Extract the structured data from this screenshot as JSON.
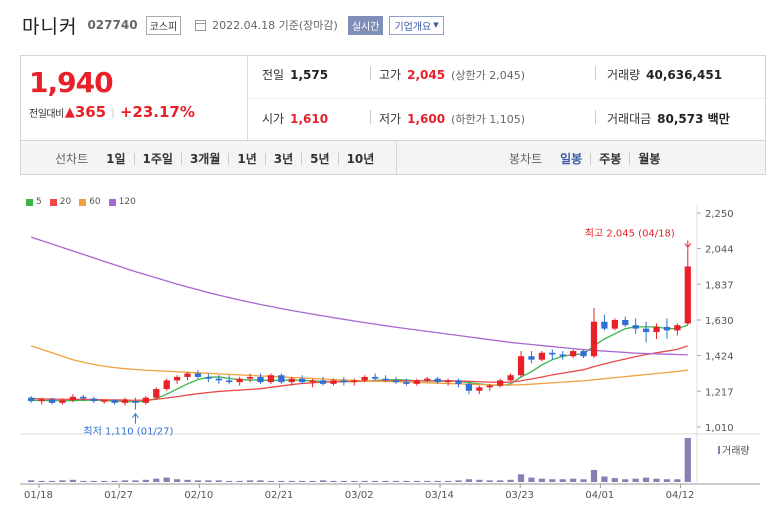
{
  "header": {
    "name": "마니커",
    "code": "027740",
    "market": "코스피",
    "date_text": "2022.04.18 기준(장마감)",
    "realtime_label": "실시간",
    "company_label": "기업개요"
  },
  "price": {
    "current": "1,940",
    "change_label": "전일대비",
    "change_value": "365",
    "change_pct": "+23.17%",
    "prev_label": "전일",
    "prev": "1,575",
    "high_label": "고가",
    "high": "2,045",
    "upper_limit": "상한가 2,045",
    "volume_label": "거래량",
    "volume": "40,636,451",
    "open_label": "시가",
    "open": "1,610",
    "low_label": "저가",
    "low": "1,600",
    "lower_limit": "하한가 1,105",
    "amount_label": "거래대금",
    "amount": "80,573 백만"
  },
  "tabs": {
    "line_label": "선차트",
    "line_tabs": [
      "1일",
      "1주일",
      "3개월",
      "1년",
      "3년",
      "5년",
      "10년"
    ],
    "candle_label": "봉차트",
    "candle_tabs": [
      "일봉",
      "주봉",
      "월봉"
    ],
    "candle_active": "일봉"
  },
  "colors": {
    "up": "#e8202a",
    "down": "#2f6fd6",
    "ma5": "#39b54a",
    "ma20": "#e84a4a",
    "ma60": "#f0a040",
    "ma120": "#a868d0"
  },
  "chart_data": {
    "type": "candlestick",
    "legend": [
      {
        "name": "5",
        "color": "#39b54a"
      },
      {
        "name": "20",
        "color": "#e84a4a"
      },
      {
        "name": "60",
        "color": "#f0a040"
      },
      {
        "name": "120",
        "color": "#a868d0"
      }
    ],
    "y_ticks": [
      "2,250",
      "2,044",
      "1,837",
      "1,630",
      "1,424",
      "1,217",
      "1,010"
    ],
    "y_range": [
      1010,
      2250
    ],
    "x_labels": [
      "01/18",
      "01/27",
      "02/10",
      "02/21",
      "03/02",
      "03/14",
      "03/23",
      "04/01",
      "04/12"
    ],
    "max_annotation": "최고 2,045 (04/18)",
    "min_annotation": "최저 1,110 (01/27)",
    "volume_label": "거래량",
    "ohlc": [
      [
        1180,
        1190,
        1150,
        1160
      ],
      [
        1160,
        1180,
        1140,
        1170
      ],
      [
        1170,
        1180,
        1140,
        1150
      ],
      [
        1150,
        1175,
        1140,
        1165
      ],
      [
        1165,
        1200,
        1155,
        1185
      ],
      [
        1185,
        1195,
        1160,
        1175
      ],
      [
        1175,
        1185,
        1150,
        1160
      ],
      [
        1160,
        1170,
        1145,
        1165
      ],
      [
        1165,
        1170,
        1140,
        1150
      ],
      [
        1150,
        1180,
        1135,
        1170
      ],
      [
        1160,
        1180,
        1110,
        1150
      ],
      [
        1150,
        1190,
        1140,
        1180
      ],
      [
        1180,
        1240,
        1175,
        1230
      ],
      [
        1230,
        1290,
        1220,
        1280
      ],
      [
        1280,
        1310,
        1260,
        1300
      ],
      [
        1300,
        1330,
        1280,
        1320
      ],
      [
        1320,
        1340,
        1290,
        1300
      ],
      [
        1300,
        1320,
        1270,
        1290
      ],
      [
        1290,
        1310,
        1260,
        1280
      ],
      [
        1280,
        1310,
        1260,
        1270
      ],
      [
        1270,
        1300,
        1250,
        1290
      ],
      [
        1290,
        1320,
        1270,
        1300
      ],
      [
        1300,
        1320,
        1260,
        1270
      ],
      [
        1270,
        1320,
        1260,
        1310
      ],
      [
        1310,
        1320,
        1260,
        1270
      ],
      [
        1270,
        1300,
        1250,
        1290
      ],
      [
        1290,
        1310,
        1260,
        1270
      ],
      [
        1270,
        1290,
        1240,
        1280
      ],
      [
        1280,
        1300,
        1250,
        1260
      ],
      [
        1260,
        1290,
        1250,
        1280
      ],
      [
        1280,
        1300,
        1250,
        1270
      ],
      [
        1270,
        1290,
        1250,
        1280
      ],
      [
        1280,
        1310,
        1270,
        1300
      ],
      [
        1300,
        1320,
        1280,
        1290
      ],
      [
        1290,
        1310,
        1270,
        1280
      ],
      [
        1280,
        1300,
        1260,
        1270
      ],
      [
        1270,
        1290,
        1250,
        1260
      ],
      [
        1260,
        1290,
        1250,
        1280
      ],
      [
        1280,
        1300,
        1270,
        1290
      ],
      [
        1290,
        1300,
        1260,
        1270
      ],
      [
        1270,
        1290,
        1250,
        1280
      ],
      [
        1280,
        1290,
        1240,
        1260
      ],
      [
        1260,
        1270,
        1200,
        1220
      ],
      [
        1220,
        1250,
        1200,
        1240
      ],
      [
        1240,
        1260,
        1220,
        1250
      ],
      [
        1250,
        1290,
        1240,
        1280
      ],
      [
        1280,
        1320,
        1270,
        1310
      ],
      [
        1310,
        1450,
        1300,
        1420
      ],
      [
        1420,
        1450,
        1380,
        1400
      ],
      [
        1400,
        1450,
        1390,
        1440
      ],
      [
        1440,
        1460,
        1400,
        1430
      ],
      [
        1430,
        1450,
        1400,
        1420
      ],
      [
        1420,
        1460,
        1410,
        1450
      ],
      [
        1450,
        1460,
        1410,
        1420
      ],
      [
        1420,
        1700,
        1410,
        1620
      ],
      [
        1620,
        1660,
        1570,
        1580
      ],
      [
        1580,
        1640,
        1570,
        1630
      ],
      [
        1630,
        1650,
        1590,
        1600
      ],
      [
        1600,
        1640,
        1550,
        1580
      ],
      [
        1580,
        1620,
        1500,
        1560
      ],
      [
        1560,
        1610,
        1520,
        1590
      ],
      [
        1590,
        1640,
        1520,
        1570
      ],
      [
        1570,
        1610,
        1540,
        1600
      ],
      [
        1610,
        2045,
        1600,
        1940
      ]
    ],
    "volume": [
      3,
      2,
      2,
      3,
      4,
      2,
      2,
      2,
      2,
      3,
      3,
      4,
      6,
      8,
      5,
      4,
      3,
      3,
      3,
      2,
      2,
      3,
      3,
      2,
      2,
      2,
      2,
      2,
      3,
      2,
      2,
      2,
      2,
      2,
      2,
      2,
      2,
      2,
      2,
      2,
      2,
      3,
      5,
      4,
      3,
      3,
      4,
      14,
      8,
      6,
      5,
      5,
      6,
      5,
      22,
      10,
      7,
      5,
      6,
      8,
      6,
      5,
      5,
      80
    ],
    "ma": {
      "5": [
        1165,
        1164,
        1163,
        1162,
        1163,
        1165,
        1166,
        1164,
        1160,
        1158,
        1156,
        1160,
        1175,
        1200,
        1230,
        1260,
        1285,
        1298,
        1300,
        1292,
        1284,
        1282,
        1282,
        1280,
        1282,
        1282,
        1280,
        1277,
        1275,
        1272,
        1272,
        1274,
        1276,
        1280,
        1282,
        1284,
        1282,
        1278,
        1276,
        1276,
        1277,
        1275,
        1268,
        1260,
        1254,
        1250,
        1260,
        1300,
        1330,
        1370,
        1400,
        1420,
        1430,
        1433,
        1480,
        1520,
        1550,
        1580,
        1590,
        1590,
        1590,
        1580,
        1580,
        1600
      ],
      "20": [
        1175,
        1173,
        1172,
        1171,
        1170,
        1170,
        1169,
        1168,
        1167,
        1166,
        1165,
        1166,
        1170,
        1178,
        1186,
        1195,
        1203,
        1210,
        1216,
        1220,
        1224,
        1228,
        1232,
        1240,
        1248,
        1256,
        1262,
        1266,
        1270,
        1272,
        1274,
        1275,
        1276,
        1277,
        1278,
        1278,
        1278,
        1278,
        1278,
        1278,
        1278,
        1277,
        1275,
        1272,
        1270,
        1268,
        1270,
        1278,
        1288,
        1300,
        1312,
        1322,
        1332,
        1342,
        1360,
        1376,
        1390,
        1404,
        1418,
        1430,
        1440,
        1450,
        1460,
        1480
      ],
      "60": [
        1480,
        1460,
        1440,
        1420,
        1400,
        1385,
        1372,
        1362,
        1354,
        1348,
        1343,
        1339,
        1336,
        1333,
        1330,
        1327,
        1324,
        1321,
        1318,
        1315,
        1312,
        1309,
        1306,
        1303,
        1300,
        1297,
        1294,
        1291,
        1288,
        1285,
        1282,
        1280,
        1278,
        1276,
        1274,
        1272,
        1270,
        1268,
        1266,
        1264,
        1262,
        1260,
        1258,
        1256,
        1254,
        1253,
        1253,
        1255,
        1258,
        1262,
        1266,
        1270,
        1274,
        1278,
        1284,
        1290,
        1296,
        1302,
        1308,
        1314,
        1320,
        1326,
        1332,
        1340
      ],
      "120": [
        2110,
        2090,
        2070,
        2050,
        2030,
        2010,
        1990,
        1970,
        1950,
        1930,
        1910,
        1892,
        1874,
        1856,
        1838,
        1821,
        1805,
        1789,
        1774,
        1760,
        1746,
        1733,
        1720,
        1708,
        1696,
        1685,
        1674,
        1664,
        1654,
        1644,
        1634,
        1624,
        1615,
        1606,
        1597,
        1588,
        1580,
        1572,
        1564,
        1556,
        1548,
        1540,
        1532,
        1524,
        1516,
        1508,
        1500,
        1494,
        1488,
        1482,
        1476,
        1470,
        1464,
        1458,
        1454,
        1450,
        1446,
        1442,
        1438,
        1436,
        1434,
        1432,
        1430,
        1428
      ]
    }
  }
}
